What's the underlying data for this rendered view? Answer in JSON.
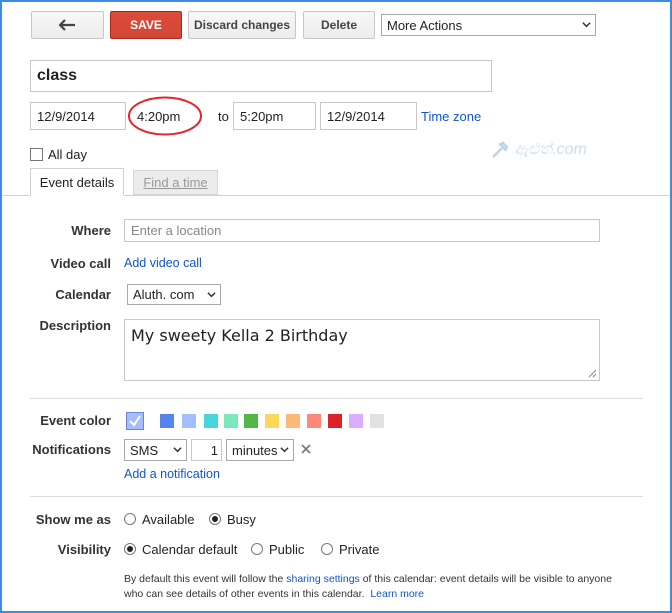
{
  "toolbar": {
    "back_icon": "back-arrow-icon",
    "save_label": "SAVE",
    "discard_label": "Discard changes",
    "delete_label": "Delete",
    "more_actions_label": "More Actions"
  },
  "event": {
    "title": "class",
    "start_date": "12/9/2014",
    "start_time": "4:20pm",
    "to_label": "to",
    "end_time": "5:20pm",
    "end_date": "12/9/2014",
    "timezone_link": "Time zone",
    "all_day_label": "All day",
    "all_day_checked": false
  },
  "watermark": {
    "text": "ඇළුත්.com"
  },
  "tabs": [
    {
      "label": "Event details",
      "active": true
    },
    {
      "label": "Find a time",
      "active": false
    }
  ],
  "details": {
    "where_label": "Where",
    "where_placeholder": "Enter a location",
    "video_label": "Video call",
    "video_link": "Add video call",
    "calendar_label": "Calendar",
    "calendar_value": "Aluth. com",
    "description_label": "Description",
    "description_value": "My sweety Kella 2  Birthday"
  },
  "color": {
    "label": "Event color",
    "selected": "#a4bdfc",
    "swatches": [
      "#5484ed",
      "#a4bdfc",
      "#46d6db",
      "#7ae7bf",
      "#51b749",
      "#fbd75b",
      "#ffb878",
      "#ff887c",
      "#dc2127",
      "#dbadff",
      "#e1e1e1"
    ]
  },
  "notifications": {
    "label": "Notifications",
    "method": "SMS",
    "amount": "1",
    "unit": "minutes",
    "remove_icon": "close-icon",
    "add_link": "Add a notification"
  },
  "show_me_as": {
    "label": "Show me as",
    "options": [
      {
        "label": "Available",
        "checked": false
      },
      {
        "label": "Busy",
        "checked": true
      }
    ]
  },
  "visibility": {
    "label": "Visibility",
    "options": [
      {
        "label": "Calendar default",
        "checked": true
      },
      {
        "label": "Public",
        "checked": false
      },
      {
        "label": "Private",
        "checked": false
      }
    ]
  },
  "footer": {
    "text1": "By default this event will follow the ",
    "sharing_link": "sharing settings",
    "text2": " of this calendar: event details will be visible to anyone",
    "text3": "who can see details of other events in this calendar.",
    "learn_more": "Learn more"
  },
  "colors": {
    "save": "#d14836",
    "link": "#1155cc",
    "annotation_circle": "#e0262a",
    "frame": "#3c8dde"
  }
}
